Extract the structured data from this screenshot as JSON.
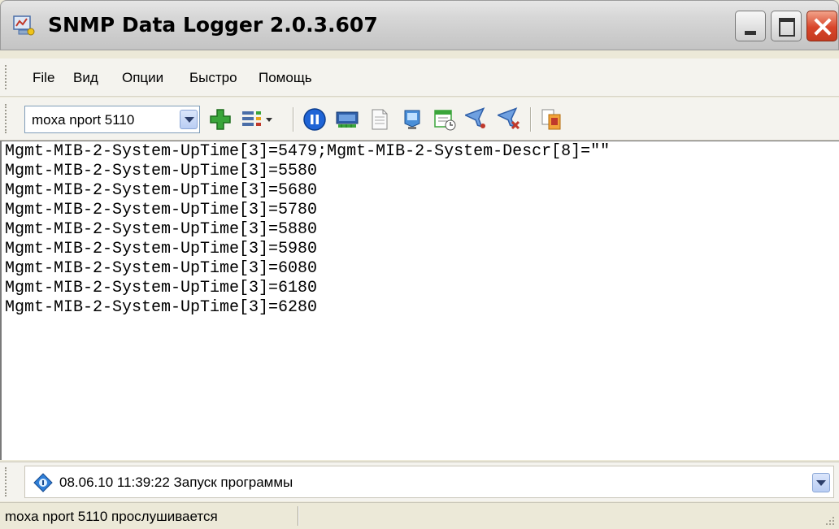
{
  "window": {
    "title": "SNMP Data Logger 2.0.3.607"
  },
  "menu": {
    "items": [
      "File",
      "Вид",
      "Опции",
      "Быстро",
      "Помощь"
    ]
  },
  "toolbar": {
    "profile_value": "moxa nport 5110"
  },
  "log": {
    "lines": [
      "Mgmt-MIB-2-System-UpTime[3]=5479;Mgmt-MIB-2-System-Descr[8]=\"\"",
      "Mgmt-MIB-2-System-UpTime[3]=5580",
      "Mgmt-MIB-2-System-UpTime[3]=5680",
      "Mgmt-MIB-2-System-UpTime[3]=5780",
      "Mgmt-MIB-2-System-UpTime[3]=5880",
      "Mgmt-MIB-2-System-UpTime[3]=5980",
      "Mgmt-MIB-2-System-UpTime[3]=6080",
      "Mgmt-MIB-2-System-UpTime[3]=6180",
      "Mgmt-MIB-2-System-UpTime[3]=6280"
    ]
  },
  "events": {
    "current": "08.06.10 11:39:22 Запуск программы"
  },
  "statusbar": {
    "text": "moxa nport 5110 прослушивается"
  },
  "icons": {
    "app": "network-monitor-icon",
    "toolbar": [
      "add-icon",
      "columns-icon",
      "pause-icon",
      "device-icon",
      "document-icon",
      "monitor-icon",
      "calendar-icon",
      "filter-icon",
      "filter-remove-icon",
      "export-icon"
    ]
  }
}
